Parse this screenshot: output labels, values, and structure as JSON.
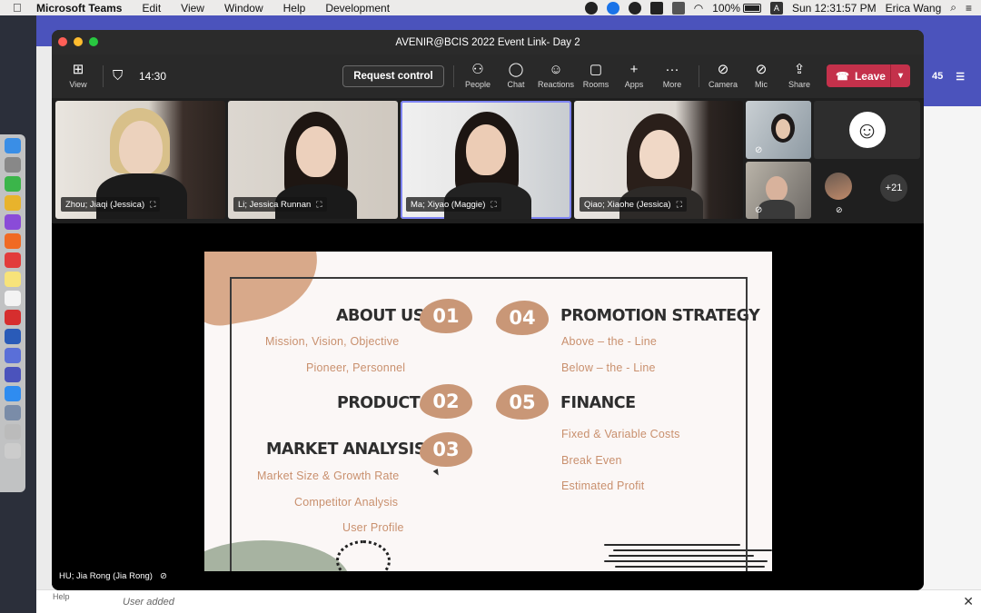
{
  "menubar": {
    "app_name": "Microsoft Teams",
    "items": [
      "Edit",
      "View",
      "Window",
      "Help",
      "Development"
    ],
    "battery": "100%",
    "datetime": "Sun 12:31:57 PM",
    "user": "Erica Wang"
  },
  "background_window": {
    "right_badge": "45",
    "help_label": "Help",
    "chat_status": "User added"
  },
  "meeting": {
    "window_title": "AVENIR@BCIS 2022 Event Link- Day 2",
    "timer": "14:30",
    "view_label": "View",
    "request_control_label": "Request control",
    "toolbar": [
      {
        "label": "People",
        "icon": "people-icon"
      },
      {
        "label": "Chat",
        "icon": "chat-icon"
      },
      {
        "label": "Reactions",
        "icon": "reactions-icon"
      },
      {
        "label": "Rooms",
        "icon": "rooms-icon"
      },
      {
        "label": "Apps",
        "icon": "apps-icon"
      },
      {
        "label": "More",
        "icon": "more-icon"
      }
    ],
    "av_controls": [
      {
        "label": "Camera",
        "icon": "camera-off-icon"
      },
      {
        "label": "Mic",
        "icon": "mic-off-icon"
      },
      {
        "label": "Share",
        "icon": "share-icon"
      }
    ],
    "leave_label": "Leave",
    "participants": [
      {
        "name": "Zhou; Jiaqi (Jessica)"
      },
      {
        "name": "Li; Jessica Runnan"
      },
      {
        "name": "Ma; Xiyao (Maggie)"
      },
      {
        "name": "Qiao; Xiaohe (Jessica)"
      }
    ],
    "extra_count": "+21",
    "presenter": "HU; Jia Rong (Jia Rong)"
  },
  "slide": {
    "sections": [
      {
        "number": "01",
        "heading": "ABOUT US",
        "items": [
          "Mission, Vision, Objective",
          "Pioneer, Personnel"
        ]
      },
      {
        "number": "02",
        "heading": "PRODUCT",
        "items": []
      },
      {
        "number": "03",
        "heading": "MARKET ANALYSIS",
        "items": [
          "Market Size & Growth Rate",
          "Competitor Analysis",
          "User Profile"
        ]
      },
      {
        "number": "04",
        "heading": "PROMOTION STRATEGY",
        "items": [
          "Above – the - Line",
          "Below – the - Line"
        ]
      },
      {
        "number": "05",
        "heading": "FINANCE",
        "items": [
          "Fixed & Variable Costs",
          "Break Even",
          "Estimated Profit"
        ]
      }
    ]
  }
}
